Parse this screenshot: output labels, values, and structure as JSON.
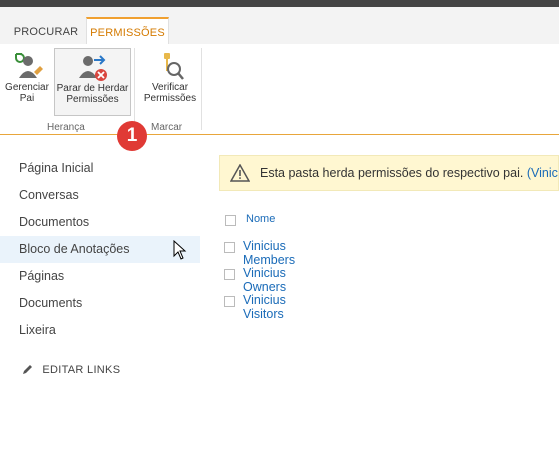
{
  "tabs": [
    {
      "label": "PROCURAR"
    },
    {
      "label": "PERMISSÕES"
    }
  ],
  "ribbon": {
    "gerenciar_pai": {
      "line1": "Gerenciar",
      "line2": "Pai"
    },
    "parar_herdar": {
      "line1": "Parar de Herdar",
      "line2": "Permissões"
    },
    "verificar": {
      "line1": "Verificar",
      "line2": "Permissões"
    },
    "groups": {
      "heranca": "Herança",
      "marcar": "Marcar"
    }
  },
  "badge": "1",
  "sidebar": {
    "items": [
      {
        "label": "Página Inicial"
      },
      {
        "label": "Conversas"
      },
      {
        "label": "Documentos"
      },
      {
        "label": "Bloco de Anotações"
      },
      {
        "label": "Páginas"
      },
      {
        "label": "Documents"
      },
      {
        "label": "Lixeira"
      }
    ],
    "edit_links": "EDITAR LINKS"
  },
  "notice": {
    "text": "Esta pasta herda permissões do respectivo pai.",
    "link": "(Vinic"
  },
  "list": {
    "header": "Nome",
    "items": [
      {
        "label": "Vinicius Members"
      },
      {
        "label": "Vinicius Owners"
      },
      {
        "label": "Vinicius Visitors"
      }
    ]
  },
  "colors": {
    "accent": "#f0a030",
    "link": "#1a6bb8",
    "badge": "#e03a35",
    "notice_bg": "#fff7d1"
  }
}
